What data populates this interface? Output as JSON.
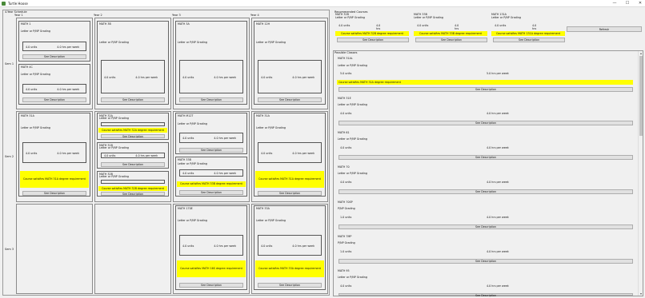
{
  "window": {
    "title": "Turtle Hoose",
    "min": "—",
    "max": "☐",
    "close": "✕",
    "icon": "app-icon"
  },
  "schedule": {
    "title": "4-Year Schedule",
    "years": [
      "Year 1",
      "Year 2",
      "Year 3",
      "Year 4"
    ],
    "semesters": [
      "Sem 1",
      "Sem 2",
      "Sem 3"
    ]
  },
  "courses": [
    {
      "name": "MATH 1",
      "grading": "Letter or P/NP Grading",
      "units": "4.0 units",
      "hours": "4.0 hrs per week",
      "req": "",
      "desc": "See Description"
    },
    {
      "name": "MATH 4C",
      "grading": "Letter or P/NP Grading",
      "units": "4.0 units",
      "hours": "4.0 hrs per week",
      "req": "",
      "desc": "See Description"
    },
    {
      "name": "MATH 3B",
      "grading": "Letter or P/NP Grading",
      "units": "4.0 units",
      "hours": "4.0 hrs per week",
      "req": "",
      "desc": "See Description"
    },
    {
      "name": "MATH 3A",
      "grading": "Letter or P/NP Grading",
      "units": "4.0 units",
      "hours": "4.0 hrs per week",
      "req": "",
      "desc": "See Description"
    },
    {
      "name": "MATH 12H",
      "grading": "Letter or P/NP Grading",
      "units": "4.0 units",
      "hours": "4.0 hrs per week",
      "req": "",
      "desc": "See Description"
    },
    {
      "name": "MATH 31A",
      "grading": "Letter or P/NP Grading",
      "units": "4.0 units",
      "hours": "4.0 hrs per week",
      "req": "Course satisfies MATH 31A degree requirement",
      "desc": "See Description"
    },
    {
      "name": "MATH 32A",
      "grading": "Letter or P/NP Grading",
      "units": "4.0 units",
      "hours": "4.0 hrs per week",
      "req": "Course satisfies MATH 32A degree requirement",
      "desc": "See Description"
    },
    {
      "name": "MATH 31B",
      "grading": "Letter or P/NP Grading",
      "units": "4.0 units",
      "hours": "4.0 hrs per week",
      "req": "",
      "desc": "See Description"
    },
    {
      "name": "MATH 32B",
      "grading": "Letter or P/NP Grading",
      "units": "4.0 units",
      "hours": "4.0 hrs per week",
      "req": "Course satisfies MATH 32B degree requirement",
      "desc": "See Description"
    },
    {
      "name": "MATH M12T",
      "grading": "Letter or P/NP Grading",
      "units": "4.0 units",
      "hours": "4.0 hrs per week",
      "req": "",
      "desc": "See Description"
    },
    {
      "name": "MATH 33B",
      "grading": "Letter or P/NP Grading",
      "units": "4.0 units",
      "hours": "4.0 hrs per week",
      "req": "Course satisfies MATH 33B degree requirement",
      "desc": "See Description"
    },
    {
      "name": "MATH 31A",
      "grading": "Letter or P/NP Grading",
      "units": "4.0 units",
      "hours": "4.0 hrs per week",
      "req": "Course satisfies MATH 31A degree requirement",
      "desc": "See Description"
    },
    {
      "name": "MATH 170E",
      "grading": "Letter or P/NP Grading",
      "units": "4.0 units",
      "hours": "4.0 hrs per week",
      "req": "Course satisfies MATH 16S degree requirement",
      "desc": "See Description"
    },
    {
      "name": "MATH 33A",
      "grading": "Letter or P/NP Grading",
      "units": "4.0 units",
      "hours": "4.0 hrs per week",
      "req": "Course satisfies MATH 33A degree requirement",
      "desc": "See Description"
    }
  ],
  "recommended": {
    "title": "Recommended Courses",
    "items": [
      {
        "name": "MATH 32B",
        "grading": "Letter or P/NP Grading",
        "units": "4.0 units",
        "hours": "4.0 hrs per week",
        "req": "Course satisfies MATH 32B degree requirement",
        "desc": "See Description"
      },
      {
        "name": "MATH 33B",
        "grading": "Letter or P/NP Grading",
        "units": "4.0 units",
        "hours": "4.0 hrs per week",
        "req": "Course satisfies MATH 33B degree requirement",
        "desc": "See Description"
      },
      {
        "name": "MATH 131A",
        "grading": "Letter or P/NP Grading",
        "units": "4.0 units",
        "hours": "4.0 hrs per week",
        "req": "Course satisfies MATH 131A degree requirement",
        "desc": "See Description"
      }
    ],
    "refresh": "Refresh"
  },
  "possible": {
    "title": "Possible Classes",
    "items": [
      {
        "name": "MATH 31AL",
        "grading": "Letter or P/NP Grading",
        "units": "5.0 units",
        "hours": "5.0 hrs per week",
        "req": "Course satisfies MATH 31A degree requirement",
        "desc": "See Description"
      },
      {
        "name": "MATH 31E",
        "grading": "Letter or P/NP Grading",
        "units": "4.0 units",
        "hours": "4.0 hrs per week",
        "req": "",
        "desc": "See Description"
      },
      {
        "name": "MATH 61",
        "grading": "Letter or P/NP Grading",
        "units": "4.0 units",
        "hours": "4.0 hrs per week",
        "req": "",
        "desc": "See Description"
      },
      {
        "name": "MATH 70",
        "grading": "Letter or P/NP Grading",
        "units": "4.0 units",
        "hours": "4.0 hrs per week",
        "req": "",
        "desc": "See Description"
      },
      {
        "name": "MATH 70SP",
        "grading": "P/NP Grading",
        "units": "1.0 units",
        "hours": "4.0 hrs per week",
        "req": "",
        "desc": "See Description"
      },
      {
        "name": "MATH 7MP",
        "grading": "P/NP Grading",
        "units": "1.0 units",
        "hours": "4.0 hrs per week",
        "req": "",
        "desc": "See Description"
      },
      {
        "name": "MATH 95",
        "grading": "Letter or P/NP Grading",
        "units": "4.0 units",
        "hours": "4.0 hrs per week",
        "req": "",
        "desc": "See Description"
      }
    ]
  }
}
